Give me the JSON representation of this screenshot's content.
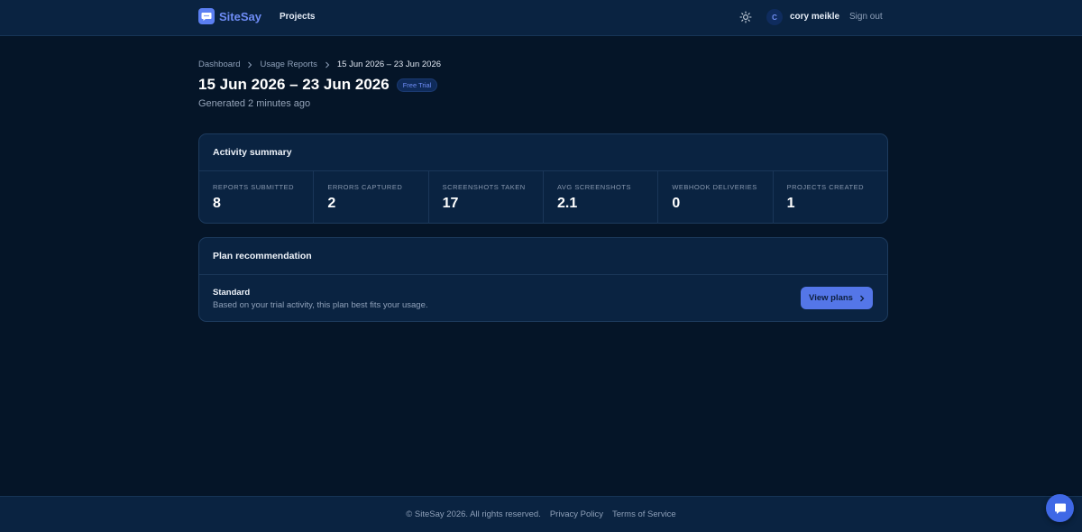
{
  "header": {
    "brand": "SiteSay",
    "nav_projects": "Projects",
    "avatar_initial": "C",
    "username": "cory meikle",
    "sign_out": "Sign out"
  },
  "breadcrumb": {
    "items": [
      "Dashboard",
      "Usage Reports",
      "15 Jun 2026 – 23 Jun 2026"
    ]
  },
  "page": {
    "title": "15 Jun 2026 – 23 Jun 2026",
    "badge": "Free Trial",
    "generated": "Generated 2 minutes ago"
  },
  "activity": {
    "title": "Activity summary",
    "stats": [
      {
        "label": "Reports submitted",
        "value": "8"
      },
      {
        "label": "Errors captured",
        "value": "2"
      },
      {
        "label": "Screenshots taken",
        "value": "17"
      },
      {
        "label": "Avg screenshots",
        "value": "2.1"
      },
      {
        "label": "Webhook deliveries",
        "value": "0"
      },
      {
        "label": "Projects created",
        "value": "1"
      }
    ]
  },
  "plan": {
    "title": "Plan recommendation",
    "name": "Standard",
    "description": "Based on your trial activity, this plan best fits your usage.",
    "button": "View plans"
  },
  "footer": {
    "copyright": "© SiteSay 2026. All rights reserved.",
    "privacy": "Privacy Policy",
    "terms": "Terms of Service"
  },
  "colors": {
    "background": "#051528",
    "surface": "#0a2341",
    "accent": "#5476e8"
  }
}
